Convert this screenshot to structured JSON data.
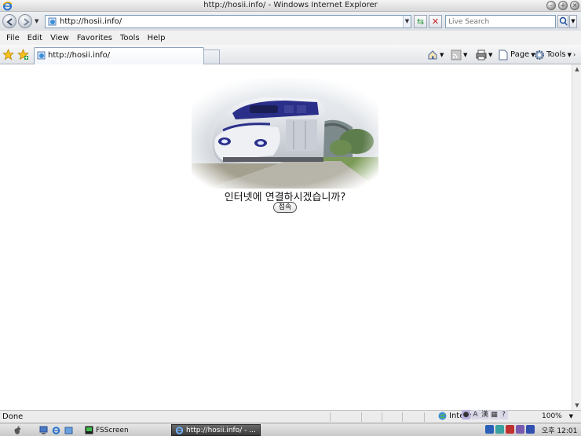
{
  "window": {
    "title": "http://hosii.info/ - Windows Internet Explorer"
  },
  "address_bar": {
    "url": "http://hosii.info/"
  },
  "search": {
    "placeholder": "Live Search"
  },
  "menu": {
    "items": [
      "File",
      "Edit",
      "View",
      "Favorites",
      "Tools",
      "Help"
    ]
  },
  "tab": {
    "label": "http://hosii.info/"
  },
  "commands": {
    "page_label": "Page",
    "tools_label": "Tools"
  },
  "content": {
    "question": "인터넷에 연결하시겠습니까?",
    "connect_label": "접속"
  },
  "status": {
    "text": "Done",
    "zone": "Internet",
    "zoom": "100%"
  },
  "taskbar": {
    "fsscreen_label": "FSScreen",
    "ie_label": "http://hosii.info/ - ...",
    "clock": "오후 12:01"
  },
  "colors": {
    "train_blue": "#2a2f8a",
    "address_border": "#7f9db9"
  }
}
